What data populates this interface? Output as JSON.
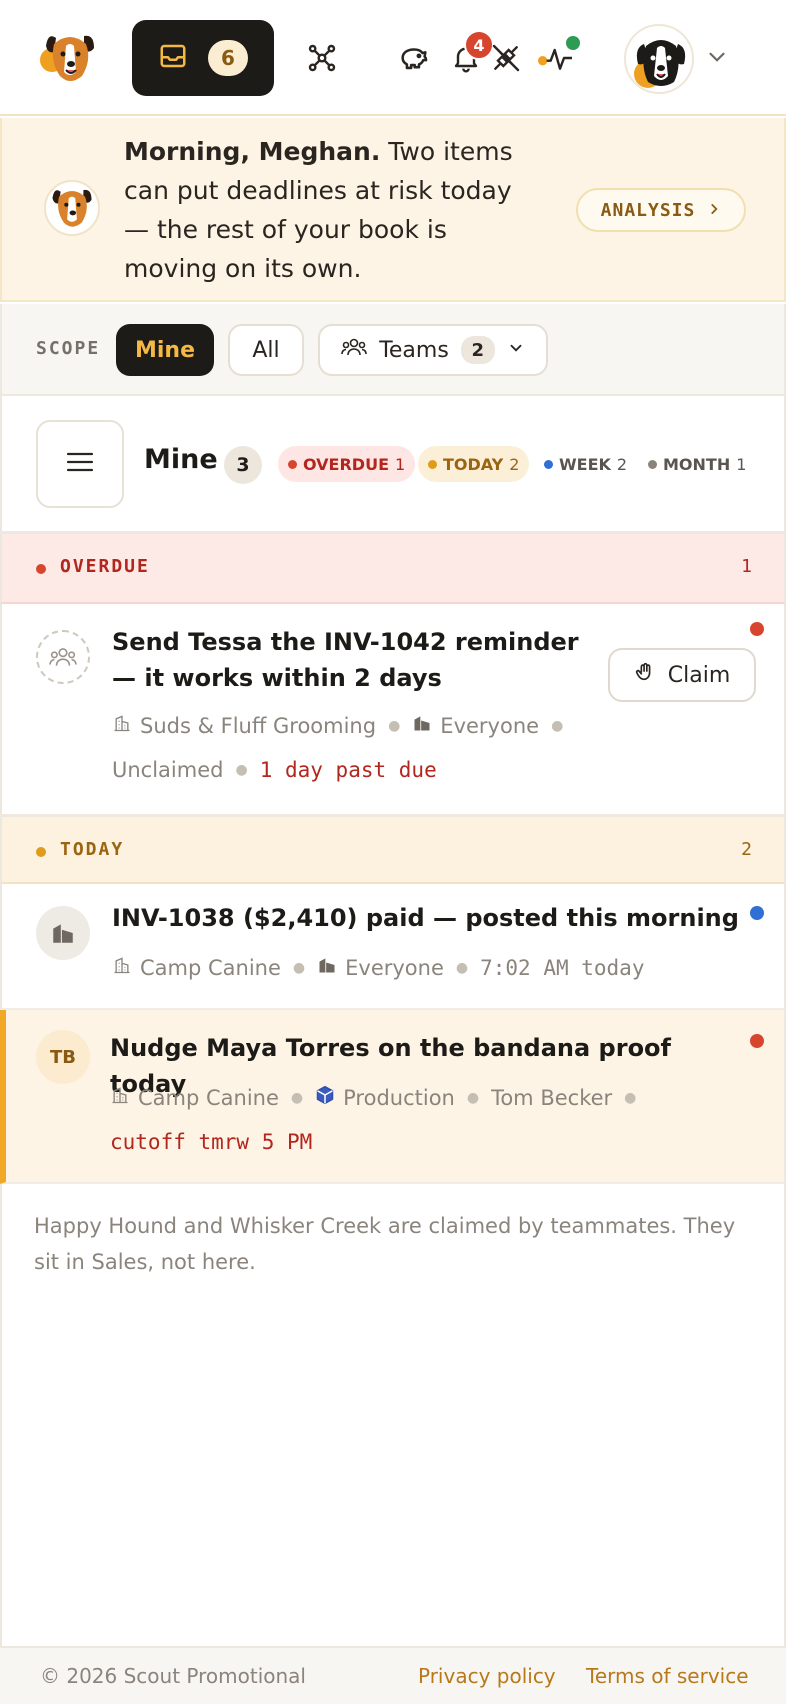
{
  "nav": {
    "inbox_count": "6",
    "bell_badge": "4"
  },
  "banner": {
    "greeting_bold": "Morning, Meghan.",
    "greeting_rest": " Two items can put deadlines at risk today — the rest of your book is moving on its own.",
    "analysis_label": "ANALYSIS"
  },
  "scope": {
    "label": "SCOPE",
    "mine": "Mine",
    "all": "All",
    "teams": "Teams",
    "teams_count": "2"
  },
  "header": {
    "title": "Mine",
    "count": "3",
    "tags": {
      "overdue": {
        "label": "OVERDUE",
        "n": "1"
      },
      "today": {
        "label": "TODAY",
        "n": "2"
      },
      "week": {
        "label": "WEEK",
        "n": "2"
      },
      "month": {
        "label": "MONTH",
        "n": "1"
      }
    }
  },
  "sections": {
    "overdue": {
      "label": "OVERDUE",
      "count": "1"
    },
    "today": {
      "label": "TODAY",
      "count": "2"
    }
  },
  "tasks": [
    {
      "title": "Send Tessa the INV-1042 reminder — it works within 2 days",
      "client": "Suds & Fluff Grooming",
      "team": "Everyone",
      "owner": "Unclaimed",
      "due": "1 day past due",
      "action": "Claim",
      "status_color": "#d8452e"
    },
    {
      "title": "INV-1038 ($2,410) paid — posted this morning",
      "client": "Camp Canine",
      "team": "Everyone",
      "time": "7:02 AM today",
      "status_color": "#2f6fd6"
    },
    {
      "initials": "TB",
      "title": "Nudge Maya Torres on the bandana proof today",
      "client": "Camp Canine",
      "team": "Production",
      "owner": "Tom Becker",
      "due": "cutoff tmrw 5 PM",
      "status_color": "#d8452e"
    }
  ],
  "footnote": "Happy Hound and Whisker Creek are claimed by teammates. They sit in Sales, not here.",
  "footer": {
    "copyright": "© 2026 Scout Promotional",
    "privacy": "Privacy policy",
    "terms": "Terms of service"
  },
  "colors": {
    "accent": "#f5b844",
    "dark": "#1d1b18",
    "overdue": "#d8452e",
    "today": "#e09a1c",
    "week": "#2f6fd6",
    "month": "#8a847c",
    "online": "#2e9b54"
  },
  "icons": [
    "dog-logo",
    "inbox-icon",
    "network-icon",
    "piggy-bank-icon",
    "bell-icon",
    "plug-off-icon",
    "pulse-icon",
    "user-avatar",
    "chevron-down-icon",
    "chevron-right-icon",
    "teams-icon",
    "menu-icon",
    "unclaimed-team-icon",
    "building-icon",
    "hand-icon",
    "package-icon"
  ]
}
